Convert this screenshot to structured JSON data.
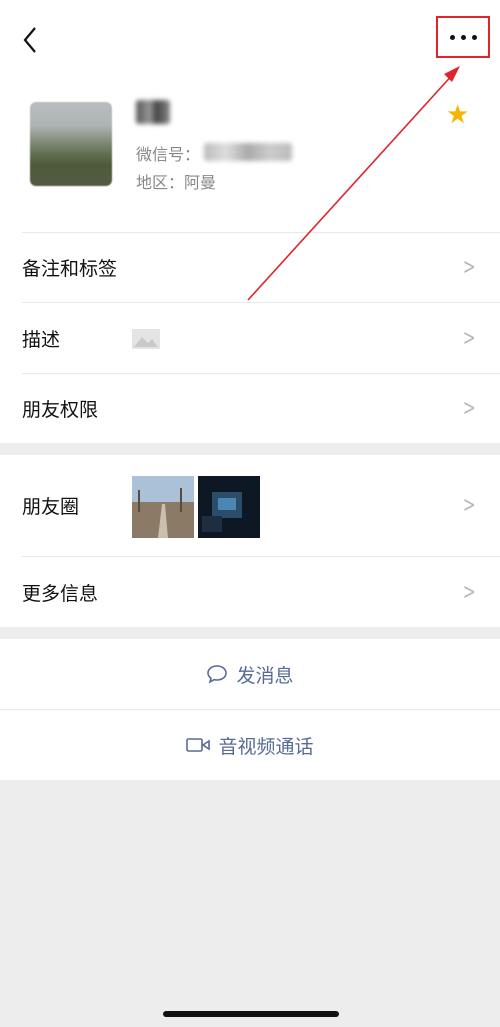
{
  "header": {
    "back_icon": "chevron-left-icon",
    "more_icon": "more-dots-icon"
  },
  "profile": {
    "name": "r彬",
    "wechat_id_label": "微信号：",
    "wechat_id_value": "hunter103",
    "region_label": "地区：",
    "region_value": "阿曼",
    "star_icon": "star-icon",
    "star_color": "#f7b500"
  },
  "rows": {
    "remarks_tags": "备注和标签",
    "description": "描述",
    "friend_permissions": "朋友权限",
    "moments": "朋友圈",
    "more_info": "更多信息"
  },
  "actions": {
    "send_message": "发消息",
    "video_call": "音视频通话",
    "accent_color": "#576b95"
  },
  "annotation": {
    "highlight_color": "#e0242a"
  }
}
